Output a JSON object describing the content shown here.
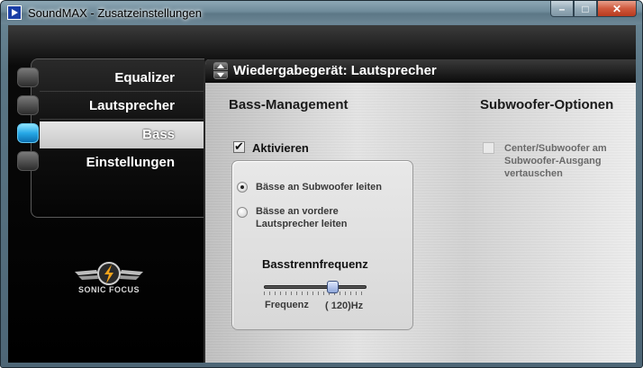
{
  "window": {
    "title": "SoundMAX - Zusatzeinstellungen",
    "controls": {
      "minimize": "–",
      "maximize": "□",
      "close": "✕"
    }
  },
  "nav": {
    "items": [
      {
        "label": "Equalizer",
        "active": false
      },
      {
        "label": "Lautsprecher",
        "active": false
      },
      {
        "label": "Bass",
        "active": true
      },
      {
        "label": "Einstellungen",
        "active": false
      }
    ],
    "logo_text": "SONIC FOCUS"
  },
  "header": {
    "title": "Wiedergabegerät: Lautsprecher"
  },
  "bass_management": {
    "title": "Bass-Management",
    "enable_label": "Aktivieren",
    "enabled": true,
    "options": [
      {
        "label": "Bässe an Subwoofer leiten",
        "selected": true
      },
      {
        "label": "Bässe an vordere Lautsprecher leiten",
        "selected": false
      }
    ],
    "crossover": {
      "title": "Basstrennfrequenz",
      "label": "Frequenz",
      "value_text": "( 120)Hz",
      "value": 120
    }
  },
  "subwoofer": {
    "title": "Subwoofer-Optionen",
    "swap_label": "Center/Subwoofer am Subwoofer-Ausgang vertauschen",
    "swap_checked": false,
    "swap_enabled": false
  },
  "colors": {
    "accent": "#26a8e6",
    "panel": "#d6d6d6",
    "header_bg": "#0b0b0b"
  }
}
